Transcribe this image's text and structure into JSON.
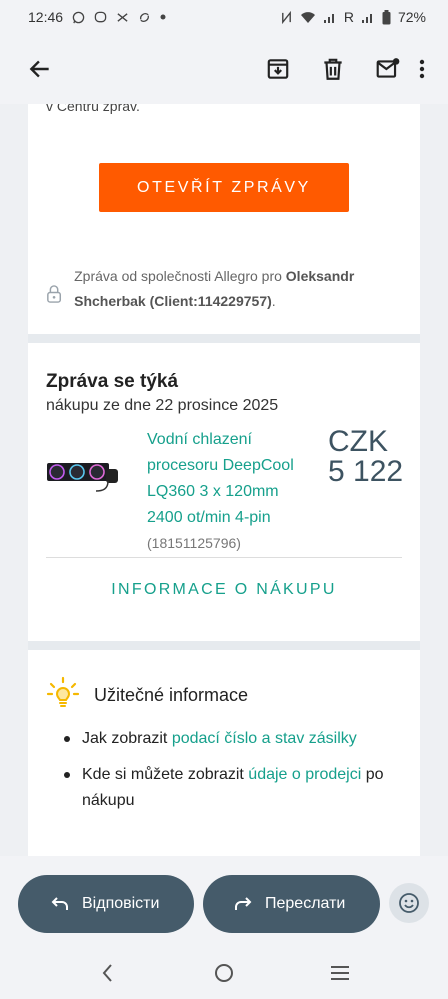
{
  "status_bar": {
    "time": "12:46",
    "network_letter": "R",
    "battery": "72%",
    "left_icons": [
      "whatsapp-icon",
      "viber-icon",
      "app-icon",
      "sync-icon",
      "dot-icon"
    ],
    "right_icons": [
      "nfc-icon",
      "wifi-icon",
      "signal-icon",
      "signal-icon",
      "battery-icon"
    ]
  },
  "toolbar": {
    "icons": [
      "back-arrow-icon",
      "archive-icon",
      "delete-icon",
      "mark-unread-icon",
      "more-vert-icon"
    ]
  },
  "email": {
    "crop_text": "v Centru zpráv.",
    "open_messages_label": "OTEVŘÍT ZPRÁVY",
    "sender_prefix": "Zpráva od společnosti Allegro pro ",
    "sender_name": "Oleksandr Shcherbak (Client:114229757)",
    "sender_suffix": ".",
    "subject_title": "Zpráva se týká",
    "subject_sub": "nákupu ze dne 22 prosince 2025",
    "product": {
      "name": "Vodní chlazení procesoru DeepCool LQ360 3 x 120mm 2400 ot/min 4-pin",
      "id": "(18151125796)",
      "price_currency": "CZK",
      "price_value": "5 122"
    },
    "purchase_info_label": "INFORMACE O NÁKUPU",
    "useful_title": "Užitečné informace",
    "useful_items": [
      {
        "prefix": "Jak zobrazit ",
        "link": "podací číslo a stav zásilky",
        "suffix": ""
      },
      {
        "prefix": "Kde si můžete zobrazit ",
        "link": "údaje o prodejci",
        "suffix": " po nákupu"
      }
    ]
  },
  "actions": {
    "reply_label": "Відповісти",
    "forward_label": "Переслати"
  },
  "colors": {
    "accent_orange": "#ff5a00",
    "link_green": "#16a08c",
    "pill_bg": "#455b6a",
    "price": "#3d5361"
  }
}
